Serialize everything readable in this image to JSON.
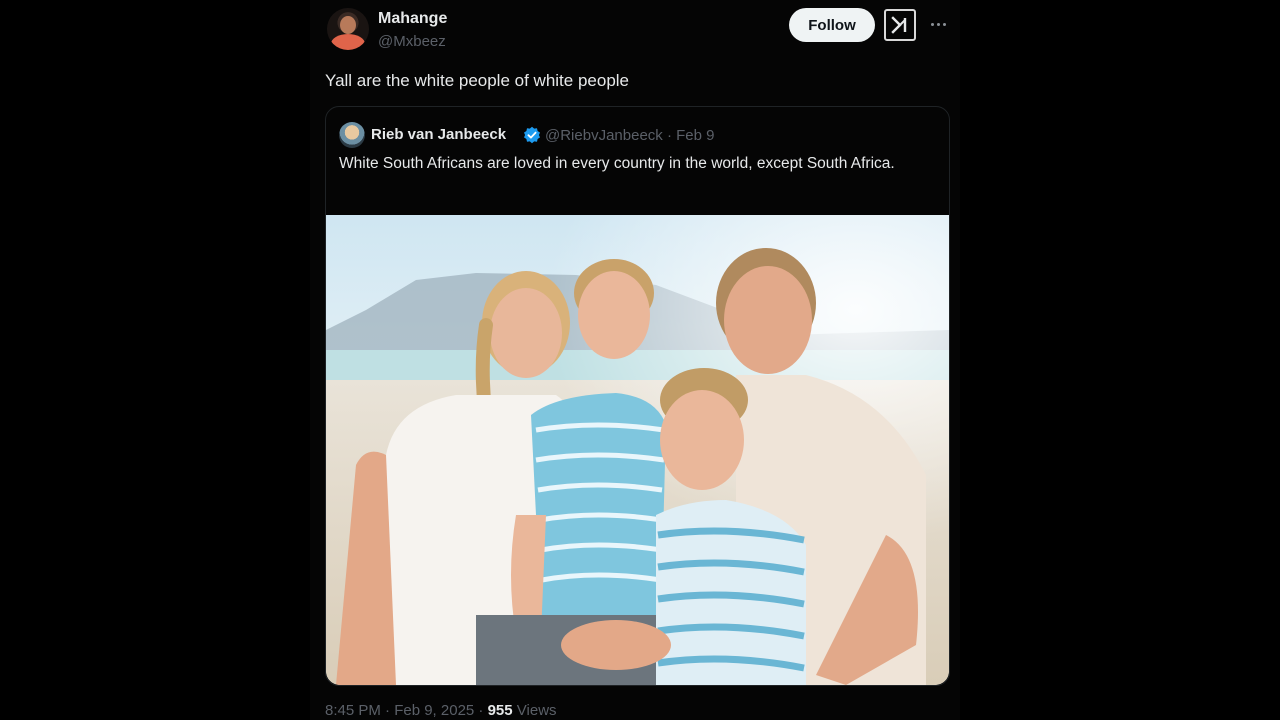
{
  "author": {
    "display_name": "Mahange",
    "handle": "@Mxbeez"
  },
  "actions": {
    "follow_label": "Follow",
    "grok_icon": "grok-icon",
    "more_icon": "more-horizontal-icon"
  },
  "tweet": {
    "text": "Yall are the white people of white people"
  },
  "quoted": {
    "display_name": "Rieb van Janbeeck",
    "verified_color": "#1d9bf0",
    "meta": "@RiebvJanbeeck · Feb 9",
    "text": "White South Africans are loved in every country in the world, except South Africa."
  },
  "footer": {
    "timestamp": "8:45 PM · Feb 9, 2025 · ",
    "views_count": "955",
    "views_label": "Views"
  }
}
